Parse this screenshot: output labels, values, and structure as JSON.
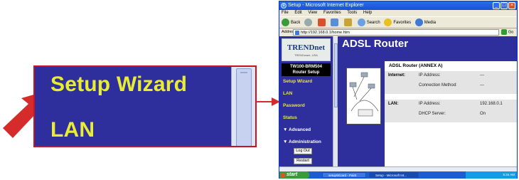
{
  "zoom": {
    "items": [
      "Setup Wizard",
      "LAN"
    ]
  },
  "window": {
    "title": "Setup - Microsoft Internet Explorer",
    "menu": [
      "File",
      "Edit",
      "View",
      "Favorites",
      "Tools",
      "Help"
    ],
    "toolbar": {
      "back": "Back",
      "search": "Search",
      "favorites": "Favorites",
      "media": "Media"
    },
    "address_label": "Address",
    "address_value": "http://192.168.0.1/home.htm",
    "go_label": "Go"
  },
  "sidebar": {
    "logo": "TRENDnet",
    "logo_sub": "TRENDware, USA",
    "model": "TW100-BRM504",
    "subtitle": "Router Setup",
    "nav": [
      "Setup Wizard",
      "LAN",
      "Password",
      "Status",
      "▼ Advanced",
      "▼ Administration"
    ],
    "buttons": [
      "Log Out",
      "Restart"
    ]
  },
  "main": {
    "banner": "ADSL Router",
    "panel_title": "ADSL Router (ANNEX A)",
    "internet": {
      "label": "Internet:",
      "k1": "IP Address:",
      "v1": "---",
      "k2": "Connection Method:",
      "v2": "---"
    },
    "lan": {
      "label": "LAN:",
      "k1": "IP Address:",
      "v1": "192.168.0.1",
      "k2": "DHCP Server:",
      "v2": "On"
    }
  },
  "taskbar": {
    "start": "start",
    "tasks": [
      "setupWizard - Paint",
      "Setup - Microsoft Int..."
    ],
    "clock": "5:34 AM"
  },
  "colors": {
    "nav_blue": "#2e2e9c",
    "nav_yellow": "#e8ec32",
    "arrow_red": "#c8141e"
  }
}
